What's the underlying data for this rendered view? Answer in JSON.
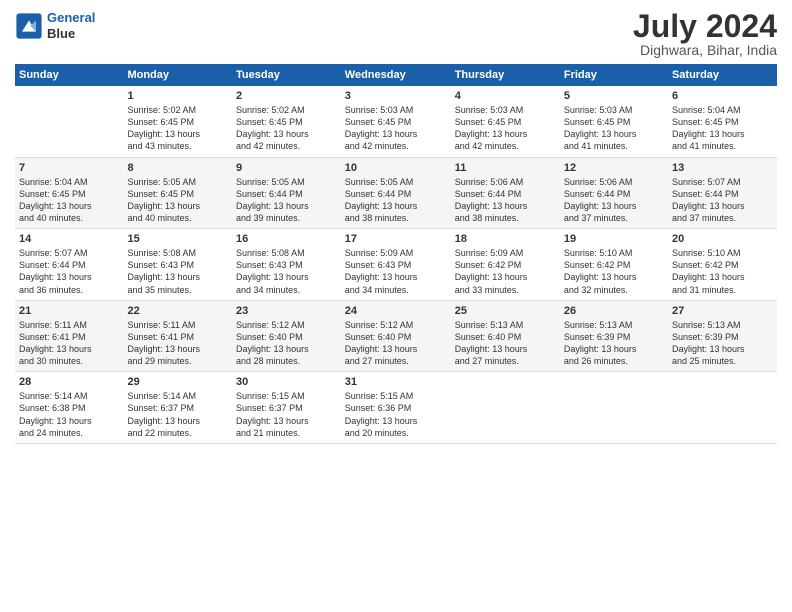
{
  "header": {
    "logo_line1": "General",
    "logo_line2": "Blue",
    "month_year": "July 2024",
    "location": "Dighwara, Bihar, India"
  },
  "weekdays": [
    "Sunday",
    "Monday",
    "Tuesday",
    "Wednesday",
    "Thursday",
    "Friday",
    "Saturday"
  ],
  "weeks": [
    [
      {
        "day": "",
        "info": ""
      },
      {
        "day": "1",
        "info": "Sunrise: 5:02 AM\nSunset: 6:45 PM\nDaylight: 13 hours\nand 43 minutes."
      },
      {
        "day": "2",
        "info": "Sunrise: 5:02 AM\nSunset: 6:45 PM\nDaylight: 13 hours\nand 42 minutes."
      },
      {
        "day": "3",
        "info": "Sunrise: 5:03 AM\nSunset: 6:45 PM\nDaylight: 13 hours\nand 42 minutes."
      },
      {
        "day": "4",
        "info": "Sunrise: 5:03 AM\nSunset: 6:45 PM\nDaylight: 13 hours\nand 42 minutes."
      },
      {
        "day": "5",
        "info": "Sunrise: 5:03 AM\nSunset: 6:45 PM\nDaylight: 13 hours\nand 41 minutes."
      },
      {
        "day": "6",
        "info": "Sunrise: 5:04 AM\nSunset: 6:45 PM\nDaylight: 13 hours\nand 41 minutes."
      }
    ],
    [
      {
        "day": "7",
        "info": "Sunrise: 5:04 AM\nSunset: 6:45 PM\nDaylight: 13 hours\nand 40 minutes."
      },
      {
        "day": "8",
        "info": "Sunrise: 5:05 AM\nSunset: 6:45 PM\nDaylight: 13 hours\nand 40 minutes."
      },
      {
        "day": "9",
        "info": "Sunrise: 5:05 AM\nSunset: 6:44 PM\nDaylight: 13 hours\nand 39 minutes."
      },
      {
        "day": "10",
        "info": "Sunrise: 5:05 AM\nSunset: 6:44 PM\nDaylight: 13 hours\nand 38 minutes."
      },
      {
        "day": "11",
        "info": "Sunrise: 5:06 AM\nSunset: 6:44 PM\nDaylight: 13 hours\nand 38 minutes."
      },
      {
        "day": "12",
        "info": "Sunrise: 5:06 AM\nSunset: 6:44 PM\nDaylight: 13 hours\nand 37 minutes."
      },
      {
        "day": "13",
        "info": "Sunrise: 5:07 AM\nSunset: 6:44 PM\nDaylight: 13 hours\nand 37 minutes."
      }
    ],
    [
      {
        "day": "14",
        "info": "Sunrise: 5:07 AM\nSunset: 6:44 PM\nDaylight: 13 hours\nand 36 minutes."
      },
      {
        "day": "15",
        "info": "Sunrise: 5:08 AM\nSunset: 6:43 PM\nDaylight: 13 hours\nand 35 minutes."
      },
      {
        "day": "16",
        "info": "Sunrise: 5:08 AM\nSunset: 6:43 PM\nDaylight: 13 hours\nand 34 minutes."
      },
      {
        "day": "17",
        "info": "Sunrise: 5:09 AM\nSunset: 6:43 PM\nDaylight: 13 hours\nand 34 minutes."
      },
      {
        "day": "18",
        "info": "Sunrise: 5:09 AM\nSunset: 6:42 PM\nDaylight: 13 hours\nand 33 minutes."
      },
      {
        "day": "19",
        "info": "Sunrise: 5:10 AM\nSunset: 6:42 PM\nDaylight: 13 hours\nand 32 minutes."
      },
      {
        "day": "20",
        "info": "Sunrise: 5:10 AM\nSunset: 6:42 PM\nDaylight: 13 hours\nand 31 minutes."
      }
    ],
    [
      {
        "day": "21",
        "info": "Sunrise: 5:11 AM\nSunset: 6:41 PM\nDaylight: 13 hours\nand 30 minutes."
      },
      {
        "day": "22",
        "info": "Sunrise: 5:11 AM\nSunset: 6:41 PM\nDaylight: 13 hours\nand 29 minutes."
      },
      {
        "day": "23",
        "info": "Sunrise: 5:12 AM\nSunset: 6:40 PM\nDaylight: 13 hours\nand 28 minutes."
      },
      {
        "day": "24",
        "info": "Sunrise: 5:12 AM\nSunset: 6:40 PM\nDaylight: 13 hours\nand 27 minutes."
      },
      {
        "day": "25",
        "info": "Sunrise: 5:13 AM\nSunset: 6:40 PM\nDaylight: 13 hours\nand 27 minutes."
      },
      {
        "day": "26",
        "info": "Sunrise: 5:13 AM\nSunset: 6:39 PM\nDaylight: 13 hours\nand 26 minutes."
      },
      {
        "day": "27",
        "info": "Sunrise: 5:13 AM\nSunset: 6:39 PM\nDaylight: 13 hours\nand 25 minutes."
      }
    ],
    [
      {
        "day": "28",
        "info": "Sunrise: 5:14 AM\nSunset: 6:38 PM\nDaylight: 13 hours\nand 24 minutes."
      },
      {
        "day": "29",
        "info": "Sunrise: 5:14 AM\nSunset: 6:37 PM\nDaylight: 13 hours\nand 22 minutes."
      },
      {
        "day": "30",
        "info": "Sunrise: 5:15 AM\nSunset: 6:37 PM\nDaylight: 13 hours\nand 21 minutes."
      },
      {
        "day": "31",
        "info": "Sunrise: 5:15 AM\nSunset: 6:36 PM\nDaylight: 13 hours\nand 20 minutes."
      },
      {
        "day": "",
        "info": ""
      },
      {
        "day": "",
        "info": ""
      },
      {
        "day": "",
        "info": ""
      }
    ]
  ]
}
